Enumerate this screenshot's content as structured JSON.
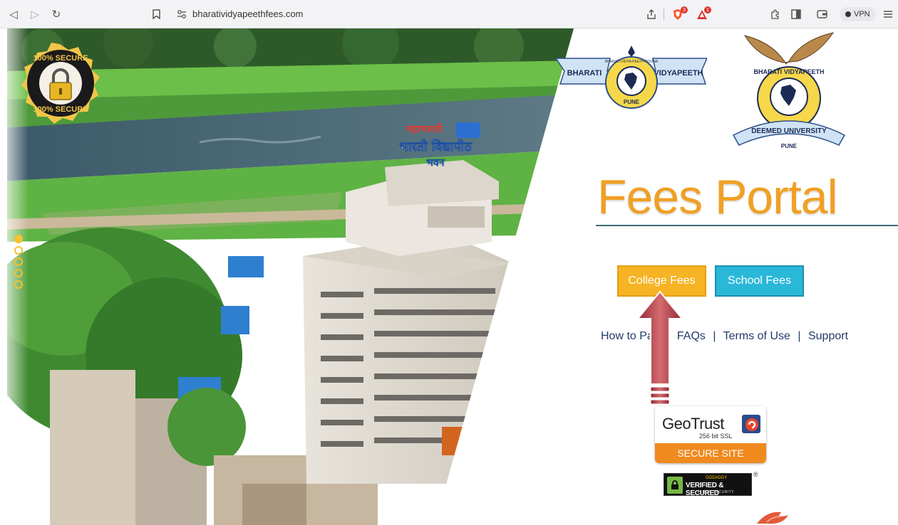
{
  "browser": {
    "url": "bharatividyapeethfees.com",
    "vpn_label": "VPN",
    "badge_shield": "3",
    "badge_alert": "1"
  },
  "hero": {
    "seal_top": "100% SECURE",
    "seal_bottom": "100% SECURE",
    "building_sign_1": "महाभारती",
    "building_sign_2": "भारती विद्यापीठ",
    "building_sign_3": "भवन",
    "carousel_dots": 5,
    "carousel_active_index": 0
  },
  "logos": {
    "bv_left": "BHARATI",
    "bv_right": "VIDYAPEETH",
    "bv_ring": "BHARATI VIDYA PEETH POONA",
    "bv_pune": "PUNE",
    "du_arc": "BHARATI VIDYAPEETH",
    "du_ribbon": "DEEMED UNIVERSITY",
    "du_pune": "PUNE"
  },
  "portal": {
    "title": "Fees Portal",
    "college_fees_label": "College Fees",
    "school_fees_label": "School Fees",
    "link_how_to_pay": "How to Pay",
    "link_faqs": "FAQs",
    "link_terms": "Terms of Use",
    "link_support": "Support",
    "link_separator": "|"
  },
  "badges": {
    "geotrust_name": "GeoTrust",
    "geotrust_sub": "256 bit SSL",
    "geotrust_bar": "SECURE SITE",
    "godaddy_top": "GODADDY",
    "godaddy_mid": "VERIFIED & SECURED",
    "godaddy_bottom": "VERIFY SECURITY",
    "registered_mark": "®"
  },
  "colors": {
    "title_orange": "#f0a024",
    "college_button": "#f6b324",
    "school_button": "#2ab8d8",
    "link_navy": "#213a6b",
    "arrow_red": "#b34a4f",
    "geotrust_orange": "#f08a1e"
  }
}
